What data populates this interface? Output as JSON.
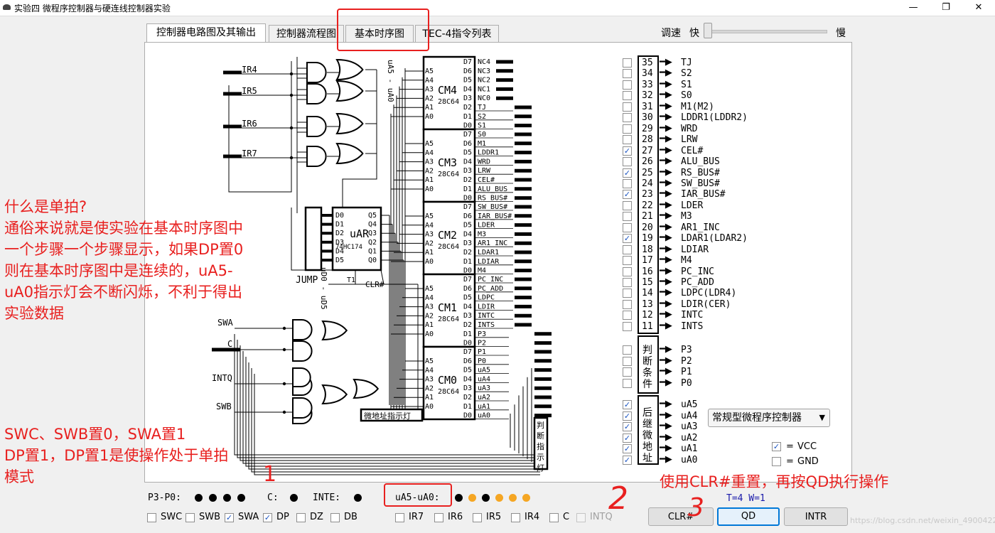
{
  "window": {
    "title": "实验四 微程序控制器与硬连线控制器实验",
    "minimize": "—",
    "maximize": "❐",
    "close": "✕"
  },
  "tabs": [
    "控制器电路图及其输出",
    "控制器流程图",
    "基本时序图",
    "TEC-4指令列表"
  ],
  "active_tab": 0,
  "speed": {
    "label": "调速",
    "fast": "快",
    "slow": "慢",
    "value_fraction": 0.0
  },
  "circuit": {
    "ir_inputs": [
      "IR4",
      "IR5",
      "IR6",
      "IR7"
    ],
    "side_inputs": [
      "SWA",
      "C",
      "INTQ",
      "SWB"
    ],
    "bus_label": "uA5 - uA0",
    "jump_label": "JUMP",
    "uar": {
      "name": "uAR",
      "chip": "74HC174",
      "d_pins": [
        "D0",
        "D1",
        "D2",
        "D3",
        "D4",
        "D5"
      ],
      "q_pins": [
        "Q5",
        "Q4",
        "Q3",
        "Q2",
        "Q1",
        "Q0"
      ],
      "t1": "T1",
      "clr": "CLR#"
    },
    "ud_label": "uD0 - uD5",
    "micro_addr_label": "微地址指示灯",
    "judge_label": "判断指示灯",
    "chip_type": "28C64",
    "addr_pins": [
      "A5",
      "A4",
      "A3",
      "A2",
      "A1",
      "A0"
    ],
    "data_pins": [
      "D7",
      "D6",
      "D5",
      "D4",
      "D3",
      "D2",
      "D1",
      "D0"
    ],
    "roms": [
      {
        "name": "CM4",
        "outputs": [
          "NC4",
          "NC3",
          "NC2",
          "NC1",
          "NC0",
          "TJ",
          "S2",
          "S1"
        ]
      },
      {
        "name": "CM3",
        "outputs": [
          "S0",
          "M1",
          "LDDR1",
          "WRD",
          "LRW",
          "CEL#",
          "ALU_BUS",
          "RS_BUS#"
        ]
      },
      {
        "name": "CM2",
        "outputs": [
          "SW_BUS#",
          "IAR_BUS#",
          "LDER",
          "M3",
          "AR1_INC",
          "LDAR1",
          "LDIAR",
          "M4"
        ]
      },
      {
        "name": "CM1",
        "outputs": [
          "PC_INC",
          "PC_ADD",
          "LDPC",
          "LDIR",
          "INTC",
          "INTS",
          "P3",
          "P2"
        ]
      },
      {
        "name": "CM0",
        "outputs": [
          "P1",
          "P0",
          "uA5",
          "uA4",
          "uA3",
          "uA2",
          "uA1",
          "uA0"
        ]
      }
    ]
  },
  "signals": [
    {
      "num": "35",
      "name": "TJ",
      "checked": false
    },
    {
      "num": "34",
      "name": "S2",
      "checked": false
    },
    {
      "num": "33",
      "name": "S1",
      "checked": false
    },
    {
      "num": "32",
      "name": "S0",
      "checked": false
    },
    {
      "num": "31",
      "name": "M1(M2)",
      "checked": false
    },
    {
      "num": "30",
      "name": "LDDR1(LDDR2)",
      "checked": false
    },
    {
      "num": "29",
      "name": "WRD",
      "checked": false
    },
    {
      "num": "28",
      "name": "LRW",
      "checked": false
    },
    {
      "num": "27",
      "name": "CEL#",
      "checked": true
    },
    {
      "num": "26",
      "name": "ALU_BUS",
      "checked": false
    },
    {
      "num": "25",
      "name": "RS_BUS#",
      "checked": true
    },
    {
      "num": "24",
      "name": "SW_BUS#",
      "checked": false
    },
    {
      "num": "23",
      "name": "IAR_BUS#",
      "checked": true
    },
    {
      "num": "22",
      "name": "LDER",
      "checked": false
    },
    {
      "num": "21",
      "name": "M3",
      "checked": false
    },
    {
      "num": "20",
      "name": "AR1_INC",
      "checked": false
    },
    {
      "num": "19",
      "name": "LDAR1(LDAR2)",
      "checked": true
    },
    {
      "num": "18",
      "name": "LDIAR",
      "checked": false
    },
    {
      "num": "17",
      "name": "M4",
      "checked": false
    },
    {
      "num": "16",
      "name": "PC_INC",
      "checked": false
    },
    {
      "num": "15",
      "name": "PC_ADD",
      "checked": false
    },
    {
      "num": "14",
      "name": "LDPC(LDR4)",
      "checked": false
    },
    {
      "num": "13",
      "name": "LDIR(CER)",
      "checked": false
    },
    {
      "num": "12",
      "name": "INTC",
      "checked": false
    },
    {
      "num": "11",
      "name": "INTS",
      "checked": false
    }
  ],
  "conditions": {
    "label": "判断条件",
    "items": [
      {
        "name": "P3",
        "checked": false
      },
      {
        "name": "P2",
        "checked": false
      },
      {
        "name": "P1",
        "checked": false
      },
      {
        "name": "P0",
        "checked": false
      }
    ]
  },
  "next_addr": {
    "label": "后继微地址",
    "items": [
      {
        "name": "uA5",
        "checked": true
      },
      {
        "name": "uA4",
        "checked": true
      },
      {
        "name": "uA3",
        "checked": true
      },
      {
        "name": "uA2",
        "checked": true
      },
      {
        "name": "uA1",
        "checked": true
      },
      {
        "name": "uA0",
        "checked": true
      }
    ]
  },
  "mode_select": {
    "value": "常规型微程序控制器",
    "arrow": "▼"
  },
  "vcc": {
    "prefix": "=",
    "label": "VCC",
    "checked": true
  },
  "gnd": {
    "prefix": "=",
    "label": "GND",
    "checked": false
  },
  "status": {
    "p_label": "P3-P0:",
    "p_leds": [
      "off",
      "off",
      "off",
      "off"
    ],
    "c_label": "C:",
    "c_led": "off",
    "inte_label": "INTE:",
    "inte_led": "off",
    "ua_label": "uA5-uA0:",
    "ua_leds": [
      "off",
      "on",
      "off",
      "on",
      "on",
      "on"
    ]
  },
  "switches": [
    {
      "name": "SWC",
      "checked": false
    },
    {
      "name": "SWB",
      "checked": false
    },
    {
      "name": "SWA",
      "checked": true
    },
    {
      "name": "DP",
      "checked": true
    },
    {
      "name": "DZ",
      "checked": false
    },
    {
      "name": "DB",
      "checked": false
    }
  ],
  "ir_switches": [
    {
      "name": "IR7",
      "checked": false,
      "disabled": false
    },
    {
      "name": "IR6",
      "checked": false,
      "disabled": false
    },
    {
      "name": "IR5",
      "checked": false,
      "disabled": false
    },
    {
      "name": "IR4",
      "checked": false,
      "disabled": false
    },
    {
      "name": "C",
      "checked": false,
      "disabled": false
    },
    {
      "name": "INTQ",
      "checked": false,
      "disabled": true
    }
  ],
  "tw_text": "T=4 W=1",
  "buttons": {
    "clr": "CLR#",
    "qd": "QD",
    "intr": "INTR"
  },
  "colors": {
    "led_off": "#000000",
    "led_on": "#f5a623",
    "annotation": "#e8201f",
    "accent": "#0078d7"
  },
  "annotations": {
    "single_step": [
      "什么是单拍?",
      "通俗来说就是使实验在基本时序图中一个步骤一个步骤显示，如果DP置0则在基本时序图中是连续的，uA5-uA0指示灯会不断闪烁，不利于得出实验数据"
    ],
    "setup": [
      "SWC、SWB置0，SWA置1",
      "DP置1，DP置1是使操作处于单拍模式"
    ],
    "usage": "使用CLR#重置，再按QD执行操作",
    "marks": [
      "1",
      "2",
      "3"
    ]
  },
  "watermark": "https://blog.csdn.net/weixin_49004221"
}
